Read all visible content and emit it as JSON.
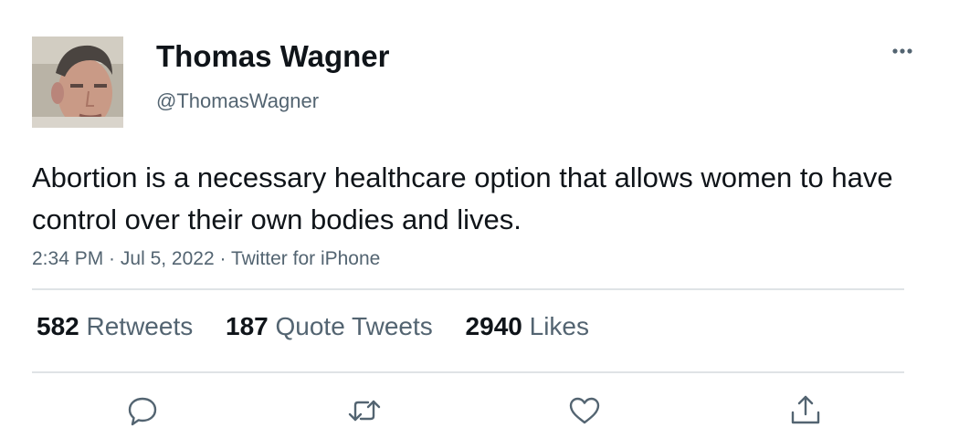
{
  "user": {
    "display_name": "Thomas Wagner",
    "handle": "@ThomasWagner"
  },
  "tweet": {
    "text": "Abortion is a necessary healthcare option that allows women to have control over their own bodies and lives.",
    "time": "2:34 PM",
    "date": "Jul 5, 2022",
    "client": "Twitter for iPhone",
    "separator": " · "
  },
  "stats": {
    "retweets": {
      "count": "582",
      "label": "Retweets"
    },
    "quotes": {
      "count": "187",
      "label": "Quote Tweets"
    },
    "likes": {
      "count": "2940",
      "label": "Likes"
    }
  },
  "icons": {
    "more": "more-horizontal-icon",
    "reply": "reply-icon",
    "retweet": "retweet-icon",
    "like": "heart-icon",
    "share": "share-icon"
  },
  "colors": {
    "text": "#0f1419",
    "secondary": "#536471",
    "divider": "#dfe3e6"
  }
}
